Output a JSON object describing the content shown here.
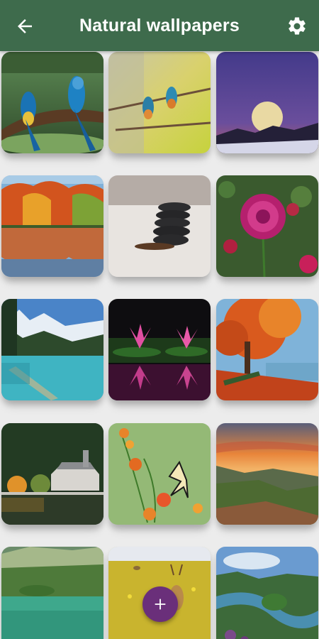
{
  "app_bar": {
    "title": "Natural wallpapers",
    "background": "#3e6b4c",
    "back_icon": "arrow-left-icon",
    "settings_icon": "gear-icon"
  },
  "wallpapers": [
    {
      "subject": "macaw parrots on branch"
    },
    {
      "subject": "kingfishers on twig"
    },
    {
      "subject": "full moon over mountains"
    },
    {
      "subject": "autumn trees reflected in lake"
    },
    {
      "subject": "stacked zen stones"
    },
    {
      "subject": "pink dahlia flower"
    },
    {
      "subject": "turquoise mountain lake"
    },
    {
      "subject": "pink water lilies"
    },
    {
      "subject": "autumn tree by lake with bench"
    },
    {
      "subject": "chapel by forest lake"
    },
    {
      "subject": "butterfly on orange flowers"
    },
    {
      "subject": "sunset over valley"
    },
    {
      "subject": "green lake with island"
    },
    {
      "subject": "deer in flower meadow"
    },
    {
      "subject": "winding river aerial view"
    }
  ],
  "fab": {
    "icon": "plus-icon",
    "color": "#6a2f7a"
  }
}
